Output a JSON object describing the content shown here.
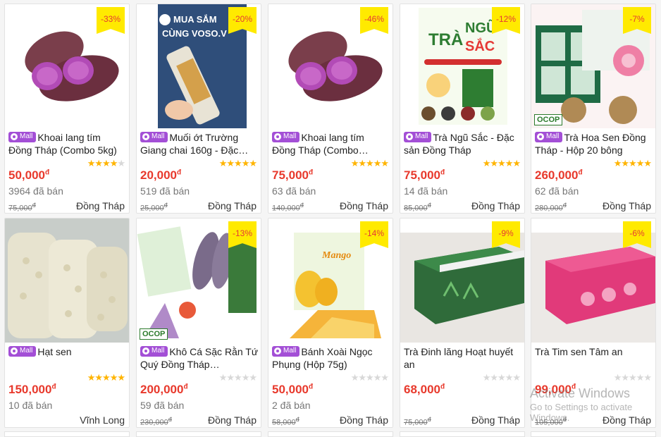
{
  "products": [
    {
      "title": "Khoai lang tím Đồng Tháp (Combo 5kg)",
      "mall": true,
      "discount": "-33%",
      "rating": 4,
      "price": "50,000",
      "sold": "3964 đã bán",
      "old_price": "75,000",
      "location": "Đồng Tháp",
      "image": "purple-sweet-potato"
    },
    {
      "title": "Muối ớt Trường Giang chai 160g - Đặc…",
      "mall": true,
      "discount": "-20%",
      "rating": 5,
      "price": "20,000",
      "sold": "519 đã bán",
      "old_price": "25,000",
      "location": "Đồng Tháp",
      "image": "chili-salt-bottle",
      "image_text": "MUA SẮM CÙNG VOSO.V"
    },
    {
      "title": "Khoai lang tím Đồng Tháp (Combo…",
      "mall": true,
      "discount": "-46%",
      "rating": 5,
      "price": "75,000",
      "sold": "63 đã bán",
      "old_price": "140,000",
      "location": "Đồng Tháp",
      "image": "purple-sweet-potato"
    },
    {
      "title": "Trà Ngũ Sắc - Đặc sản Đồng Tháp",
      "mall": true,
      "discount": "-12%",
      "rating": 5,
      "price": "75,000",
      "sold": "14 đã bán",
      "old_price": "85,000",
      "location": "Đồng Tháp",
      "image": "five-color-tea",
      "image_text": "TRÀ NGŨ SẮC"
    },
    {
      "title": "Trà Hoa Sen Đồng Tháp - Hộp 20 bông",
      "mall": true,
      "discount": "-7%",
      "rating": 5,
      "price": "260,000",
      "sold": "62 đã bán",
      "old_price": "280,000",
      "location": "Đồng Tháp",
      "image": "lotus-tea-box",
      "image_text": "OCOP"
    },
    {
      "title": "Hạt sen",
      "mall": true,
      "discount": "",
      "rating": 5,
      "price": "150,000",
      "sold": "10 đã bán",
      "old_price": "",
      "location": "Vĩnh Long",
      "image": "lotus-seeds"
    },
    {
      "title": "Khô Cá Sặc Rằn Tứ Quý Đồng Tháp…",
      "mall": true,
      "discount": "-13%",
      "rating": 0,
      "price": "200,000",
      "sold": "59 đã bán",
      "old_price": "230,000",
      "location": "Đồng Tháp",
      "image": "dried-fish",
      "image_text": "OCOP"
    },
    {
      "title": "Bánh Xoài Ngọc Phụng (Hộp 75g)",
      "mall": true,
      "discount": "-14%",
      "rating": 0,
      "price": "50,000",
      "sold": "2 đã bán",
      "old_price": "58,000",
      "location": "Đồng Tháp",
      "image": "mango-cake",
      "image_text": "Mango"
    },
    {
      "title": "Trà Đinh lăng Hoạt huyết an",
      "mall": false,
      "discount": "-9%",
      "rating": 0,
      "price": "68,000",
      "sold": "",
      "old_price": "75,000",
      "location": "Đồng Tháp",
      "image": "dinh-lang-tea-box"
    },
    {
      "title": "Trà Tim sen Tâm an",
      "mall": false,
      "discount": "-6%",
      "rating": 0,
      "price": "99,000",
      "sold": "",
      "old_price": "105,000",
      "location": "Đồng Tháp",
      "image": "lotus-heart-tea-box"
    }
  ],
  "labels": {
    "mall": "Mall",
    "currency": "đ"
  },
  "watermark": {
    "line1": "Activate Windows",
    "line2": "Go to Settings to activate Windows."
  },
  "colors": {
    "price": "#e8392c",
    "badge_bg": "#ffea00",
    "mall_bg": "#a34fd6",
    "star": "#ffb400"
  }
}
